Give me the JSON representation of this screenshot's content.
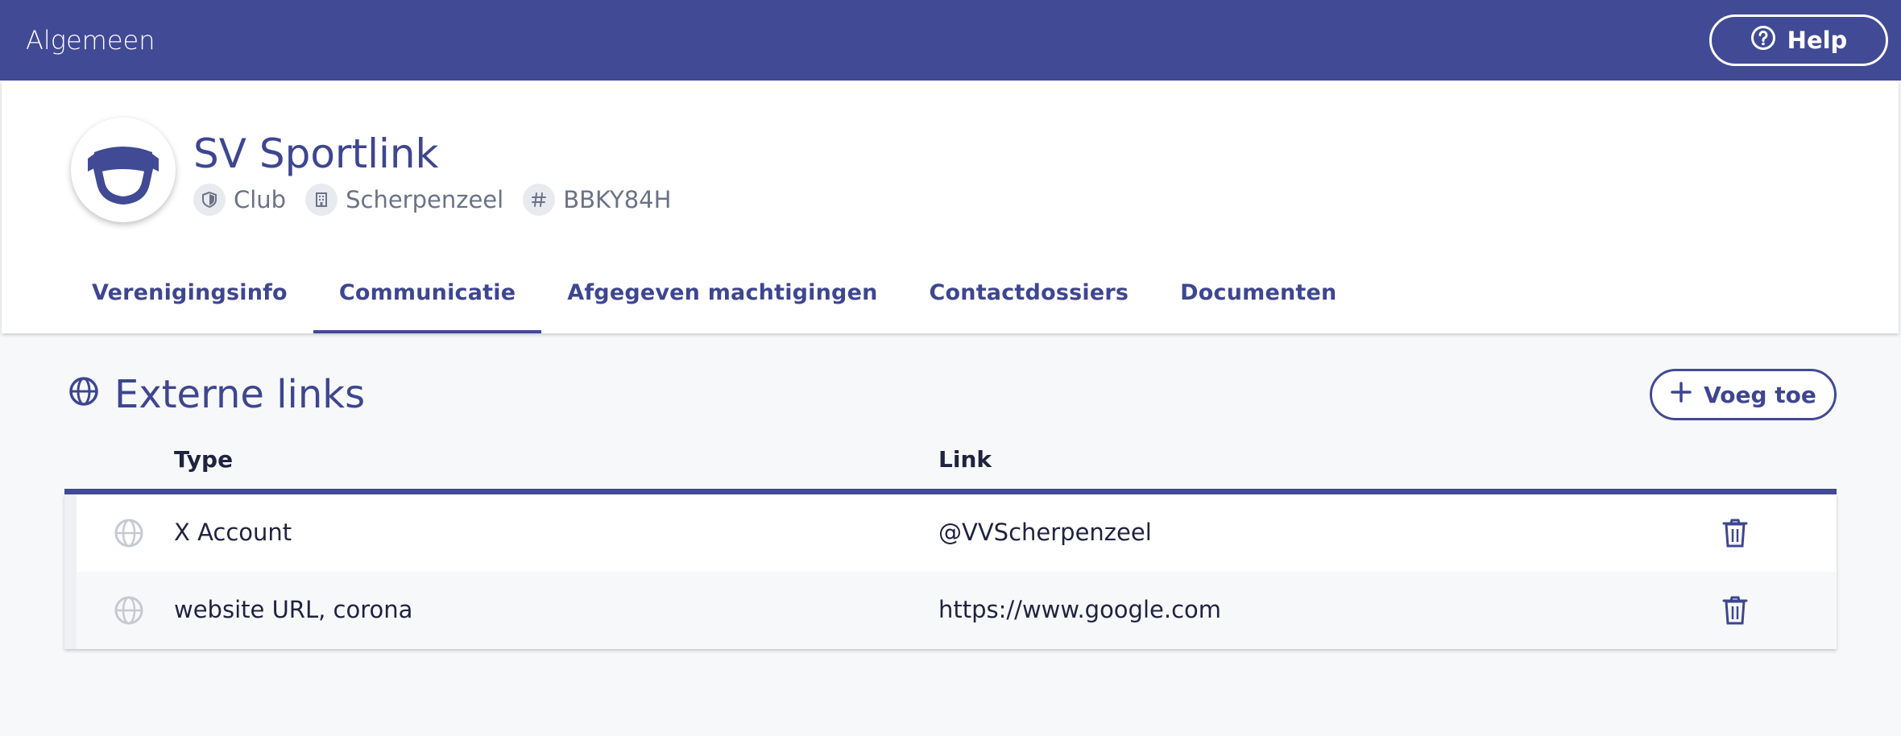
{
  "topbar": {
    "title": "Algemeen",
    "help_label": "Help"
  },
  "club": {
    "name": "SV Sportlink",
    "meta": [
      {
        "icon": "shield-icon",
        "label": "Club"
      },
      {
        "icon": "building-icon",
        "label": "Scherpenzeel"
      },
      {
        "icon": "hash-icon",
        "label": "BBKY84H"
      }
    ]
  },
  "tabs": [
    {
      "label": "Verenigingsinfo",
      "active": false
    },
    {
      "label": "Communicatie",
      "active": true
    },
    {
      "label": "Afgegeven machtigingen",
      "active": false
    },
    {
      "label": "Contactdossiers",
      "active": false
    },
    {
      "label": "Documenten",
      "active": false
    }
  ],
  "section": {
    "title": "Externe links",
    "add_label": "Voeg toe"
  },
  "table": {
    "headers": {
      "type": "Type",
      "link": "Link"
    },
    "rows": [
      {
        "type": "X Account",
        "link": "@VVScherpenzeel"
      },
      {
        "type": "website URL, corona",
        "link": "https://www.google.com"
      }
    ]
  },
  "colors": {
    "primary": "#414a94",
    "text": "#1f2340",
    "muted": "#6b7287",
    "background": "#f7f8fa"
  }
}
